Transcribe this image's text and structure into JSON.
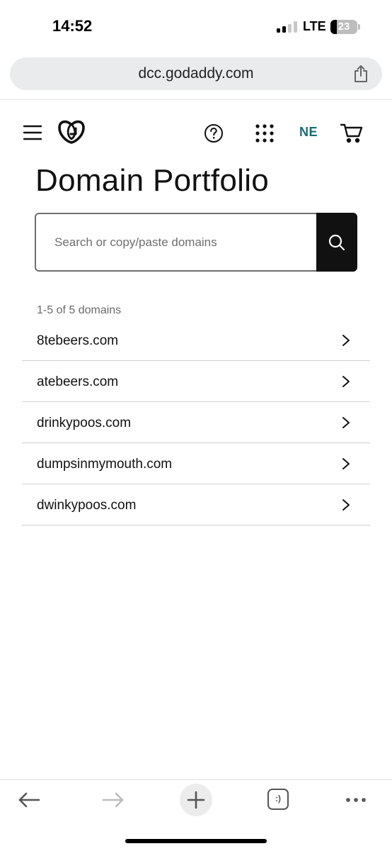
{
  "status_bar": {
    "time": "14:52",
    "network": "LTE",
    "battery_level": "23",
    "signal_bars": 2,
    "signal_bars_total": 4,
    "battery_fraction": 0.23
  },
  "browser": {
    "url": "dcc.godaddy.com",
    "share_icon": "share-icon"
  },
  "header": {
    "menu_icon": "hamburger-menu-icon",
    "logo_icon": "godaddy-logo-icon",
    "help_icon": "help-circle-icon",
    "apps_icon": "apps-grid-icon",
    "account_initials": "NE",
    "cart_icon": "cart-icon",
    "account_color": "#1a6a74"
  },
  "page": {
    "title": "Domain Portfolio"
  },
  "search": {
    "placeholder": "Search or copy/paste domains",
    "value": "",
    "button_icon": "search-icon"
  },
  "domains": {
    "count_label": "1-5 of 5 domains",
    "items": [
      {
        "name": "8tebeers.com"
      },
      {
        "name": "atebeers.com"
      },
      {
        "name": "drinkypoos.com"
      },
      {
        "name": "dumpsinmymouth.com"
      },
      {
        "name": "dwinkypoos.com"
      }
    ]
  },
  "toolbar": {
    "back_icon": "back-arrow-icon",
    "forward_icon": "forward-arrow-icon",
    "new_tab_icon": "plus-icon",
    "tabs_label": ":)",
    "more_icon": "more-dots-icon"
  }
}
